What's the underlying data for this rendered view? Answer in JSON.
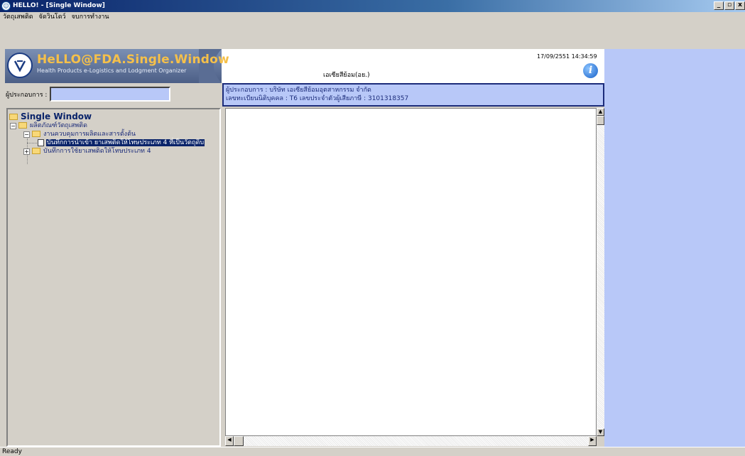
{
  "window": {
    "title": "HELLO! - [Single Window]",
    "buttons": [
      "_",
      "́",
      "x"
    ]
  },
  "menu": {
    "items": [
      "วัตถุเสพติด",
      "จัดวินโดว์",
      "จบการทำงาน"
    ]
  },
  "banner": {
    "logo_title": "HeLLO@FDA.Single.Window",
    "logo_subtitle": "Health Products e-Logistics and Lodgment Organizer",
    "center_label": "เอเซียสีย้อม(อย.)",
    "datetime": "17/09/2551 14:34:59",
    "info_icon": "info-icon"
  },
  "operator": {
    "label": "ผู้ประกอบการ :",
    "value": ""
  },
  "company": {
    "line1": "ผู้ประกอบการ : บริษัท เอเซียสีย้อมอุตสาหกรรม จำกัด",
    "line2": "เลขทะเบียนนิติบุคคล : T6 เลขประจำตัวผู้เสียภาษี : 3101318357"
  },
  "tree": {
    "root": "Single Window",
    "level1": "ผลิตภัณฑ์วัตถุเสพติด",
    "level2": "งานควบคุมการผลิตและสารตั้งต้น",
    "item_selected": "บันทึกการนำเข้า ยาเสพติดให้โทษประเภท 4 ที่เป็นวัตถุดิบ",
    "item_other": "บันทึกการใช้ยาเสพติดให้โทษประเภท 4"
  },
  "status": {
    "text": "Ready"
  },
  "colors": {
    "titlebar": "#0a246a",
    "panel_blue": "#b8c8f8",
    "selection": "#0a246a"
  }
}
